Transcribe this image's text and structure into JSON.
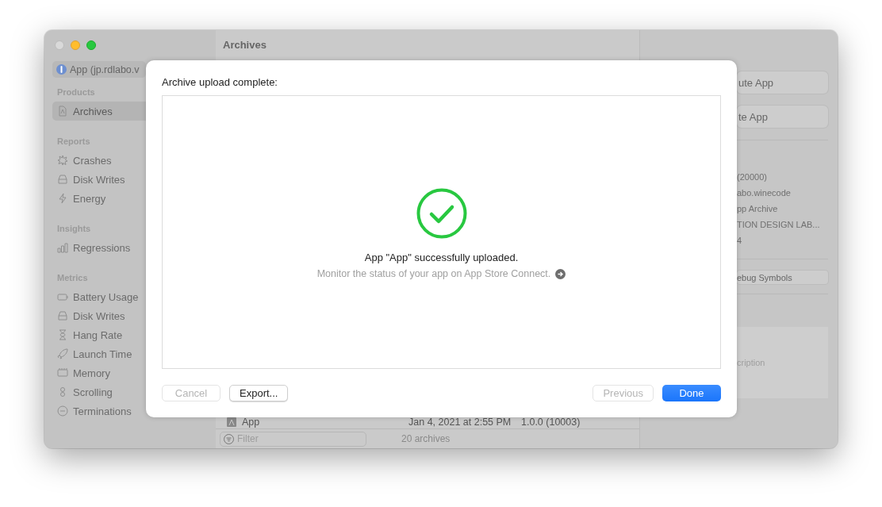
{
  "sidebar": {
    "project": "App (jp.rdlabo.v",
    "sections": [
      {
        "title": "Products",
        "items": [
          {
            "label": "Archives",
            "kind": "archive",
            "selected": true
          }
        ]
      },
      {
        "title": "Reports",
        "items": [
          {
            "label": "Crashes",
            "kind": "crash",
            "selected": false
          },
          {
            "label": "Disk Writes",
            "kind": "disk",
            "selected": false
          },
          {
            "label": "Energy",
            "kind": "energy",
            "selected": false
          }
        ]
      },
      {
        "title": "Insights",
        "items": [
          {
            "label": "Regressions",
            "kind": "bars",
            "selected": false
          }
        ]
      },
      {
        "title": "Metrics",
        "items": [
          {
            "label": "Battery Usage",
            "kind": "battery",
            "selected": false
          },
          {
            "label": "Disk Writes",
            "kind": "disk",
            "selected": false
          },
          {
            "label": "Hang Rate",
            "kind": "hourglass",
            "selected": false
          },
          {
            "label": "Launch Time",
            "kind": "rocket",
            "selected": false
          },
          {
            "label": "Memory",
            "kind": "memory",
            "selected": false
          },
          {
            "label": "Scrolling",
            "kind": "scroll",
            "selected": false
          },
          {
            "label": "Terminations",
            "kind": "terminate",
            "selected": false
          }
        ]
      }
    ]
  },
  "archives": {
    "title": "Archives",
    "rows": [
      {
        "name": "App",
        "date": "Jan 4, 2021 at 2:55 PM",
        "version": "1.0.0 (10003)"
      }
    ],
    "filter": {
      "placeholder": "Filter"
    },
    "count": "20 archives"
  },
  "inspector": {
    "buttons": [
      "ute App",
      "te App"
    ],
    "details": [
      "(20000)",
      "abo.winecode",
      "pp Archive",
      "TION DESIGN LAB...",
      "4"
    ],
    "symbols_button": "ebug Symbols",
    "description": "cription"
  },
  "sheet": {
    "title": "Archive upload complete:",
    "message": "App \"App\" successfully uploaded.",
    "link": "Monitor the status of your app on App Store Connect.",
    "left_buttons": [
      {
        "label": "Cancel",
        "disabled": true,
        "default": false
      },
      {
        "label": "Export...",
        "disabled": false,
        "default": false
      }
    ],
    "right_buttons": [
      {
        "label": "Previous",
        "disabled": true,
        "default": false
      },
      {
        "label": "Done",
        "disabled": false,
        "default": true
      }
    ]
  }
}
